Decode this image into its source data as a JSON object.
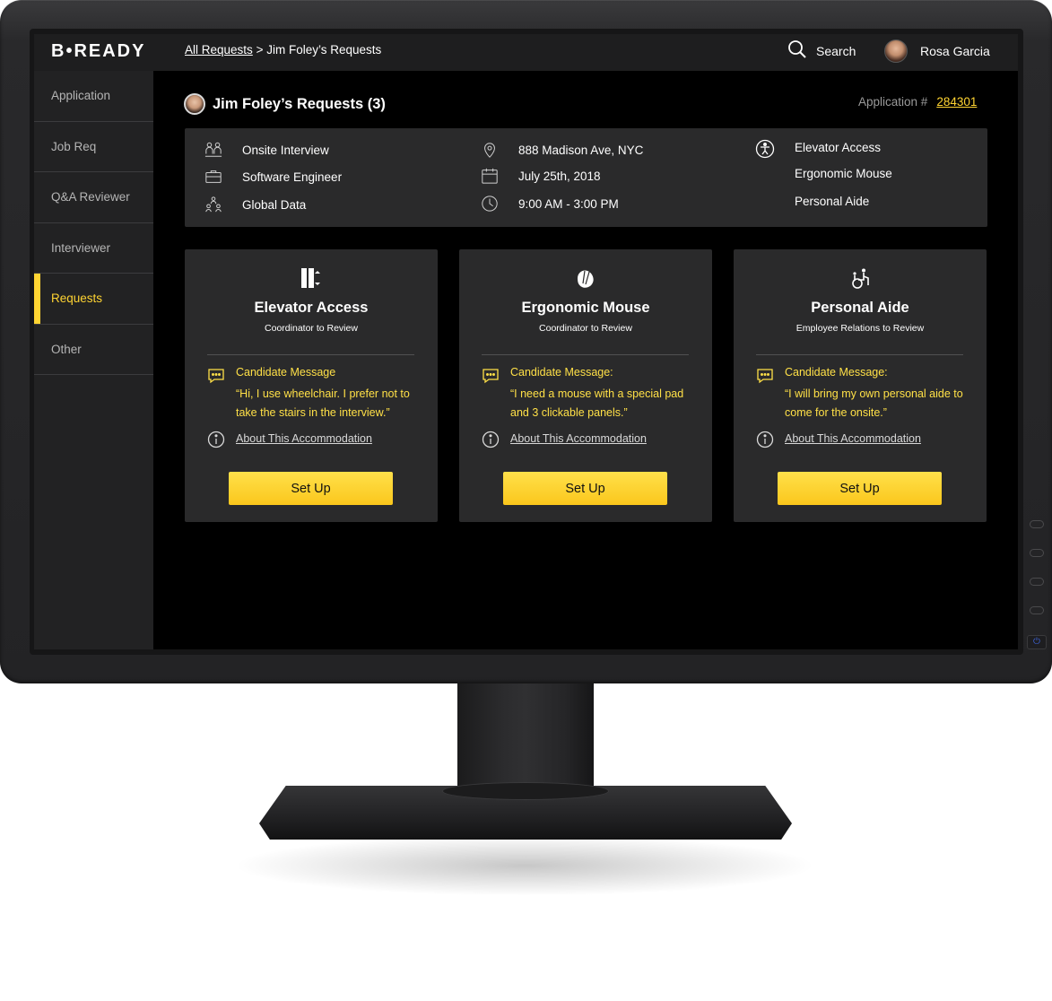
{
  "brand": {
    "logo_text": "B•READY"
  },
  "breadcrumb": {
    "root": "All Requests",
    "separator": ">",
    "current": "Jim Foley’s Requests"
  },
  "search": {
    "label": "Search"
  },
  "user": {
    "name": "Rosa Garcia"
  },
  "sidebar": {
    "items": [
      {
        "label": "Application"
      },
      {
        "label": "Job Req"
      },
      {
        "label": "Q&A Reviewer"
      },
      {
        "label": "Interviewer"
      },
      {
        "label": "Requests",
        "active": true
      },
      {
        "label": "Other"
      }
    ]
  },
  "page": {
    "title": "Jim Foley’s Requests (3)",
    "application_label": "Application #",
    "application_number": "284301"
  },
  "summary": {
    "event": "Onsite Interview",
    "role": "Software Engineer",
    "team": "Global Data",
    "location": "888 Madison Ave, NYC",
    "date": "July 25th, 2018",
    "time": "9:00 AM - 3:00 PM",
    "accommodations": [
      "Elevator Access",
      "Ergonomic Mouse",
      "Personal Aide"
    ]
  },
  "cards": [
    {
      "icon": "elevator-icon",
      "title": "Elevator Access",
      "subtitle": "Coordinator to Review",
      "message_label": "Candidate Message",
      "message": "“Hi, I use wheelchair. I prefer not to take the stairs in the interview.”",
      "about_link": "About This Accommodation",
      "button": "Set Up"
    },
    {
      "icon": "mouse-icon",
      "title": "Ergonomic Mouse",
      "subtitle": "Coordinator to Review",
      "message_label": "Candidate Message:",
      "message": "“I need a mouse with a special pad and 3 clickable panels.”",
      "about_link": "About This Accommodation",
      "button": "Set Up"
    },
    {
      "icon": "wheelchair-aide-icon",
      "title": "Personal Aide",
      "subtitle": "Employee Relations to Review",
      "message_label": "Candidate Message:",
      "message": "“I will bring my own personal aide to come for the onsite.”",
      "about_link": "About This Accommodation",
      "button": "Set Up"
    }
  ],
  "colors": {
    "accent": "#ffd432",
    "background": "#000000",
    "panel": "#2a2a2b",
    "sidebar": "#222223",
    "topbar": "#1e1e1f"
  }
}
